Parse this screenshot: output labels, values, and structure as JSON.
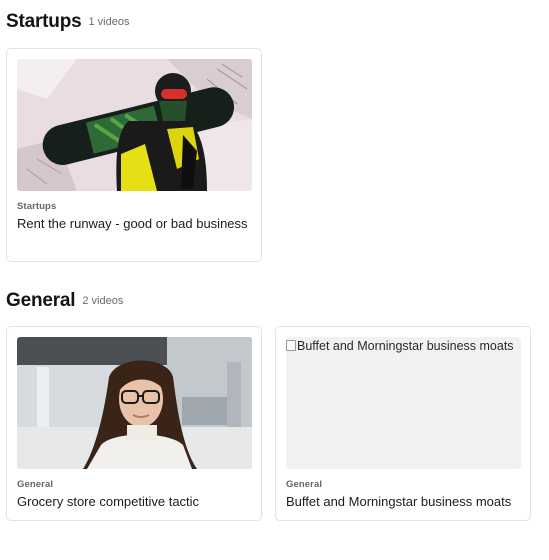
{
  "sections": [
    {
      "title": "Startups",
      "count": "1 videos",
      "videos": [
        {
          "category": "Startups",
          "title": "Rent the runway - good or bad business"
        }
      ]
    },
    {
      "title": "General",
      "count": "2 videos",
      "videos": [
        {
          "category": "General",
          "title": "Grocery store competitive tactic"
        },
        {
          "category": "General",
          "title": "Buffet and Morningstar business moats",
          "image_alt": "Buffet and Morningstar business moats"
        }
      ]
    }
  ]
}
